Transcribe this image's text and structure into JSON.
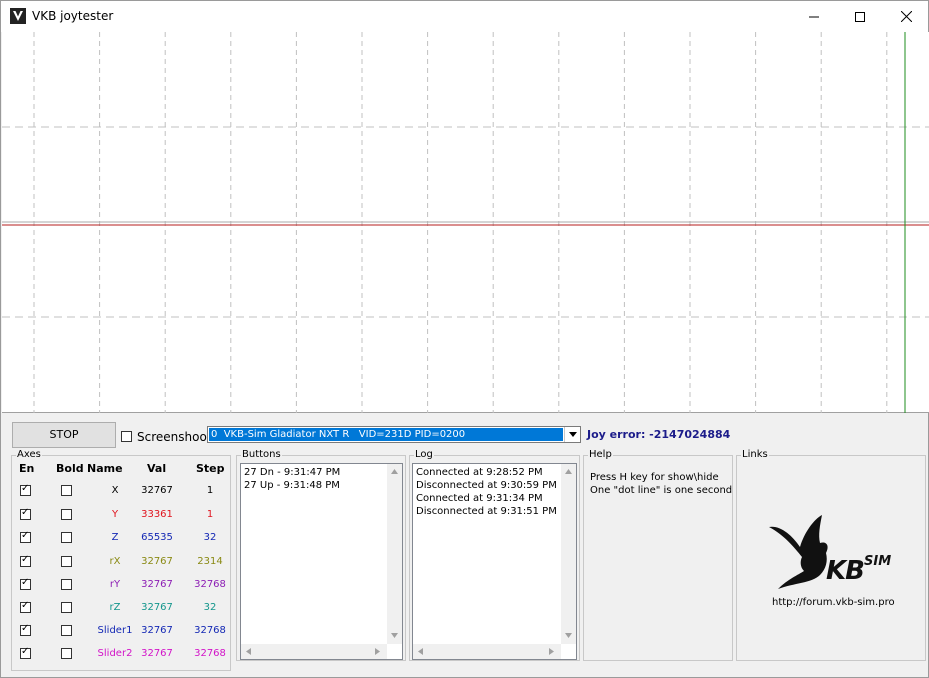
{
  "window": {
    "title": "VKB joytester"
  },
  "controls": {
    "stop_label": "STOP",
    "screenshot_label": "Screenshoot",
    "screenshot_checked": false,
    "device_selected": "0  VKB-Sim Gladiator NXT R   VID=231D PID=0200",
    "joy_error": "Joy error: -2147024884"
  },
  "axes": {
    "group_label": "Axes",
    "headers": {
      "en": "En",
      "bold": "Bold",
      "name": "Name",
      "val": "Val",
      "step": "Step"
    },
    "rows": [
      {
        "enabled": true,
        "bold": false,
        "name": "X",
        "val": "32767",
        "step": "1",
        "color": "#000000"
      },
      {
        "enabled": true,
        "bold": false,
        "name": "Y",
        "val": "33361",
        "step": "1",
        "color": "#e0141e"
      },
      {
        "enabled": true,
        "bold": false,
        "name": "Z",
        "val": "65535",
        "step": "32",
        "color": "#1428b4"
      },
      {
        "enabled": true,
        "bold": false,
        "name": "rX",
        "val": "32767",
        "step": "2314",
        "color": "#8a8a14"
      },
      {
        "enabled": true,
        "bold": false,
        "name": "rY",
        "val": "32767",
        "step": "32768",
        "color": "#8c1eb4"
      },
      {
        "enabled": true,
        "bold": false,
        "name": "rZ",
        "val": "32767",
        "step": "32",
        "color": "#14968c"
      },
      {
        "enabled": true,
        "bold": false,
        "name": "Slider1",
        "val": "32767",
        "step": "32768",
        "color": "#1428b4"
      },
      {
        "enabled": true,
        "bold": false,
        "name": "Slider2",
        "val": "32767",
        "step": "32768",
        "color": "#d214c8"
      }
    ]
  },
  "buttons_panel": {
    "label": "Buttons",
    "entries": [
      "27 Dn - 9:31:47 PM",
      "27 Up - 9:31:48 PM"
    ]
  },
  "log_panel": {
    "label": "Log",
    "entries": [
      "",
      "Connected at 9:28:52 PM",
      "Disconnected at 9:30:59 PM",
      "Connected at 9:31:34 PM",
      "Disconnected at 9:31:51 PM"
    ]
  },
  "help_panel": {
    "label": "Help",
    "lines": [
      "Press H key for show\\hide",
      "One \"dot line\" is one second"
    ]
  },
  "links_panel": {
    "label": "Links",
    "logo_text": "VKBSIM",
    "url": "http://forum.vkb-sim.pro"
  },
  "colors": {
    "accent": "#0078d7",
    "plot_red_line": "#b41e1e",
    "plot_green_line": "#1e8c1e",
    "joy_error": "#1c1c8a"
  }
}
